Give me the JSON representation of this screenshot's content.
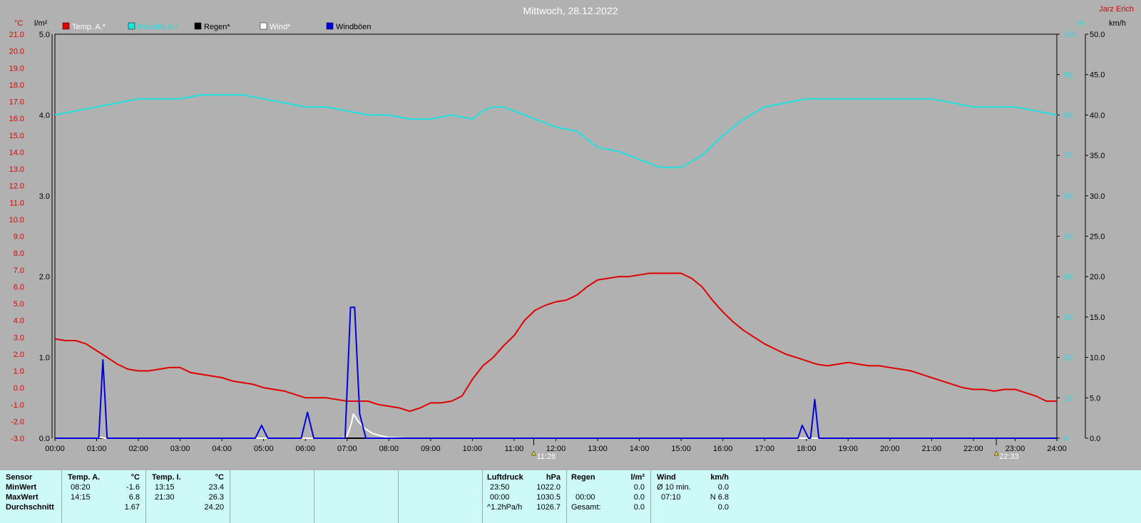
{
  "title": "Mittwoch, 28.12.2022",
  "author": "Jarz Erich",
  "legend": [
    {
      "name": "Temp. A.*",
      "color": "#e00000"
    },
    {
      "name": "Feuchte A.*",
      "color": "#20e0e0"
    },
    {
      "name": "Regen*",
      "color": "#000000"
    },
    {
      "name": "Wind*",
      "color": "#ffffff"
    },
    {
      "name": "Windböen",
      "color": "#0000e0"
    }
  ],
  "units": {
    "temp": "°C",
    "rain": "l/m²",
    "hum": "%",
    "wind": "km/h"
  },
  "markers": [
    {
      "time": "11:28",
      "x": 11.47
    },
    {
      "time": "22:33",
      "x": 22.55
    }
  ],
  "chart_data": {
    "type": "line",
    "xlim": [
      0,
      24
    ],
    "x_ticks": [
      "00:00",
      "01:00",
      "02:00",
      "03:00",
      "04:00",
      "05:00",
      "06:00",
      "07:00",
      "08:00",
      "09:00",
      "10:00",
      "11:00",
      "12:00",
      "13:00",
      "14:00",
      "15:00",
      "16:00",
      "17:00",
      "18:00",
      "19:00",
      "20:00",
      "21:00",
      "22:00",
      "23:00",
      "24:00"
    ],
    "axes": {
      "temp": {
        "lim": [
          -3,
          21
        ],
        "ticks": [
          "-3.0",
          "-2.0",
          "-1.0",
          "0.0",
          "1.0",
          "2.0",
          "3.0",
          "4.0",
          "5.0",
          "6.0",
          "7.0",
          "8.0",
          "9.0",
          "10.0",
          "11.0",
          "12.0",
          "13.0",
          "14.0",
          "15.0",
          "16.0",
          "17.0",
          "18.0",
          "19.0",
          "20.0",
          "21.0"
        ]
      },
      "rain": {
        "lim": [
          0,
          5
        ],
        "ticks": [
          "0.0",
          "1.0",
          "2.0",
          "3.0",
          "4.0",
          "5.0"
        ]
      },
      "hum": {
        "lim": [
          0,
          100
        ],
        "ticks": [
          "0",
          "10",
          "20",
          "30",
          "40",
          "50",
          "60",
          "70",
          "80",
          "90",
          "100"
        ]
      },
      "wind": {
        "lim": [
          0,
          50
        ],
        "ticks": [
          "0.0",
          "5.0",
          "10.0",
          "15.0",
          "20.0",
          "25.0",
          "30.0",
          "35.0",
          "40.0",
          "45.0",
          "50.0"
        ]
      }
    },
    "grid": true,
    "series": [
      {
        "name": "Temp. A.*",
        "axis": "temp",
        "color": "#e00000",
        "x": [
          0,
          0.25,
          0.5,
          0.75,
          1.0,
          1.25,
          1.5,
          1.75,
          2.0,
          2.25,
          2.5,
          2.75,
          3.0,
          3.25,
          3.5,
          3.75,
          4.0,
          4.25,
          4.5,
          4.75,
          5.0,
          5.25,
          5.5,
          5.75,
          6.0,
          6.25,
          6.5,
          6.75,
          7.0,
          7.25,
          7.5,
          7.75,
          8.0,
          8.25,
          8.5,
          8.75,
          9.0,
          9.25,
          9.5,
          9.75,
          10.0,
          10.25,
          10.5,
          10.75,
          11.0,
          11.25,
          11.5,
          11.75,
          12.0,
          12.25,
          12.5,
          12.75,
          13.0,
          13.25,
          13.5,
          13.75,
          14.0,
          14.25,
          14.5,
          14.75,
          15.0,
          15.25,
          15.5,
          15.75,
          16.0,
          16.25,
          16.5,
          16.75,
          17.0,
          17.25,
          17.5,
          17.75,
          18.0,
          18.25,
          18.5,
          18.75,
          19.0,
          19.25,
          19.5,
          19.75,
          20.0,
          20.25,
          20.5,
          20.75,
          21.0,
          21.25,
          21.5,
          21.75,
          22.0,
          22.25,
          22.5,
          22.75,
          23.0,
          23.25,
          23.5,
          23.75,
          24.0
        ],
        "values": [
          2.9,
          2.8,
          2.8,
          2.6,
          2.2,
          1.8,
          1.4,
          1.1,
          1.0,
          1.0,
          1.1,
          1.2,
          1.2,
          0.9,
          0.8,
          0.7,
          0.6,
          0.4,
          0.3,
          0.2,
          0.0,
          -0.1,
          -0.2,
          -0.4,
          -0.6,
          -0.6,
          -0.6,
          -0.7,
          -0.8,
          -0.8,
          -0.8,
          -1.0,
          -1.1,
          -1.2,
          -1.4,
          -1.2,
          -0.9,
          -0.9,
          -0.8,
          -0.5,
          0.5,
          1.3,
          1.8,
          2.5,
          3.1,
          4.0,
          4.6,
          4.9,
          5.1,
          5.2,
          5.5,
          6.0,
          6.4,
          6.5,
          6.6,
          6.6,
          6.7,
          6.8,
          6.8,
          6.8,
          6.8,
          6.5,
          6.0,
          5.2,
          4.5,
          3.9,
          3.4,
          3.0,
          2.6,
          2.3,
          2.0,
          1.8,
          1.6,
          1.4,
          1.3,
          1.4,
          1.5,
          1.4,
          1.3,
          1.3,
          1.2,
          1.1,
          1.0,
          0.8,
          0.6,
          0.4,
          0.2,
          0.0,
          -0.1,
          -0.1,
          -0.2,
          -0.1,
          -0.1,
          -0.3,
          -0.5,
          -0.8,
          -0.8
        ]
      },
      {
        "name": "Feuchte A.*",
        "axis": "hum",
        "color": "#20e0e0",
        "x": [
          0,
          0.5,
          1.0,
          1.5,
          2.0,
          2.5,
          3.0,
          3.5,
          4.0,
          4.5,
          5.0,
          5.5,
          6.0,
          6.5,
          7.0,
          7.5,
          8.0,
          8.5,
          9.0,
          9.5,
          10.0,
          10.25,
          10.5,
          10.75,
          11.0,
          11.5,
          12.0,
          12.5,
          13.0,
          13.5,
          14.0,
          14.5,
          15.0,
          15.5,
          16.0,
          16.5,
          17.0,
          17.5,
          18.0,
          18.5,
          19.0,
          19.5,
          20.0,
          20.5,
          21.0,
          21.5,
          22.0,
          22.5,
          23.0,
          23.5,
          24.0
        ],
        "values": [
          80,
          81,
          82,
          83,
          84,
          84,
          84,
          85,
          85,
          85,
          84,
          83,
          82,
          82,
          81,
          80,
          80,
          79,
          79,
          80,
          79,
          81,
          82,
          82,
          81,
          79,
          77,
          76,
          72,
          71,
          69,
          67,
          67,
          70,
          75,
          79,
          82,
          83,
          84,
          84,
          84,
          84,
          84,
          84,
          84,
          83,
          82,
          82,
          82,
          81,
          80
        ]
      },
      {
        "name": "Regen*",
        "axis": "rain",
        "color": "#000000",
        "x": [
          0,
          24
        ],
        "values": [
          0,
          0
        ]
      },
      {
        "name": "Wind*",
        "axis": "wind",
        "color": "#ffffff",
        "x": [
          0,
          1.0,
          1.1,
          1.2,
          1.4,
          6.9,
          7.0,
          7.1,
          7.15,
          7.25,
          7.4,
          7.6,
          7.8,
          8.0,
          8.2,
          8.4,
          8.5,
          24.0
        ],
        "values": [
          0,
          0,
          0.1,
          0,
          0,
          0,
          0.3,
          1.8,
          3.0,
          2.2,
          1.3,
          0.6,
          0.3,
          0.1,
          0.05,
          0,
          0,
          0
        ]
      },
      {
        "name": "Windböen",
        "axis": "wind",
        "color": "#0000e0",
        "x": [
          0,
          1.05,
          1.15,
          1.25,
          1.3,
          4.8,
          4.95,
          5.1,
          5.9,
          6.05,
          6.2,
          6.95,
          7.08,
          7.18,
          7.3,
          7.45,
          17.8,
          17.9,
          18.05,
          18.1,
          18.2,
          18.3,
          24.0
        ],
        "values": [
          0,
          0,
          9.7,
          0,
          0,
          0,
          1.6,
          0,
          0,
          3.2,
          0,
          0,
          16.2,
          16.2,
          3.0,
          0,
          0,
          1.6,
          0,
          0,
          4.8,
          0,
          0
        ]
      }
    ]
  },
  "summary": {
    "row_labels": [
      "Sensor",
      "MinWert",
      "MaxWert",
      "Durchschnitt"
    ],
    "temp_a": {
      "header": "Temp. A.",
      "unit": "°C",
      "min_time": "08:20",
      "min_val": "-1.6",
      "max_time": "14:15",
      "max_val": "6.8",
      "avg": "1.67"
    },
    "temp_i": {
      "header": "Temp. I.",
      "unit": "°C",
      "min_time": "13:15",
      "min_val": "23.4",
      "max_time": "21:30",
      "max_val": "26.3",
      "avg": "24.20"
    },
    "pressure": {
      "header": "Luftdruck",
      "unit": "hPa",
      "r1_label": "23:50",
      "r1_val": "1022.0",
      "r2_label": "00:00",
      "r2_val": "1030.5",
      "r3_label": "^1.2hPa/h",
      "r3_val": "1026.7"
    },
    "rain": {
      "header": "Regen",
      "unit": "l/m²",
      "r2_label": "00:00",
      "r2_val": "0.0",
      "r3_label": "Gesamt:",
      "r3_val": "0.0",
      "r1_val": "0.0"
    },
    "wind": {
      "header": "Wind",
      "unit": "km/h",
      "r1_label": "Ø 10 min.",
      "r1_val": "0.0",
      "r2_label": "07:10",
      "r2_val": "N 6.8",
      "r3_val": "0.0"
    }
  }
}
